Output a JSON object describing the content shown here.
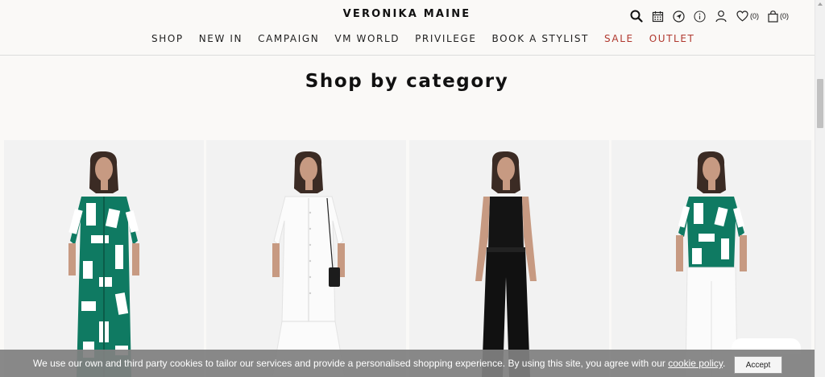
{
  "brand": {
    "logo": "VERONIKA MAINE"
  },
  "nav": {
    "items": [
      {
        "label": "SHOP"
      },
      {
        "label": "NEW IN"
      },
      {
        "label": "CAMPAIGN"
      },
      {
        "label": "VM WORLD"
      },
      {
        "label": "PRIVILEGE"
      },
      {
        "label": "BOOK A STYLIST"
      },
      {
        "label": "SALE"
      },
      {
        "label": "OUTLET"
      }
    ],
    "highlight_color": "#b0382e"
  },
  "header_icons": {
    "search": "search-icon",
    "calendar": "calendar-icon",
    "location": "location-icon",
    "info": "info-icon",
    "account": "user-icon",
    "wishlist": "heart-icon",
    "wishlist_count": "(0)",
    "bag": "shopping-bag-icon",
    "bag_count": "(0)"
  },
  "main": {
    "heading": "Shop by category",
    "cards": [
      {
        "image": "model-green-print-dress"
      },
      {
        "image": "model-white-shirt-dress"
      },
      {
        "image": "model-black-top-pants"
      },
      {
        "image": "model-green-print-shirt"
      }
    ]
  },
  "cookie_banner": {
    "text": "We use our own and third party cookies to tailor our services and provide a personalised shopping experience. By using this site, you agree with our ",
    "link": "cookie policy",
    "suffix": ".",
    "accept_label": "Accept"
  }
}
